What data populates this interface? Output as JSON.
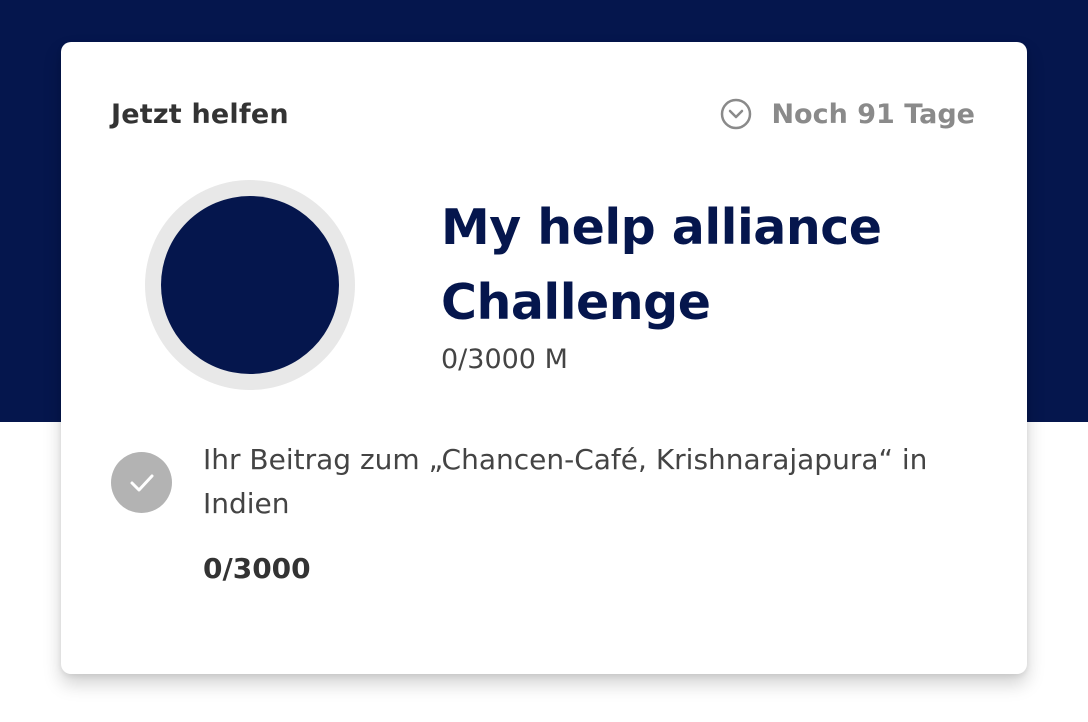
{
  "header": {
    "cta_label": "Jetzt helfen",
    "time_left": "Noch 91 Tage",
    "clock_icon": "clock-icon"
  },
  "challenge": {
    "title": "My help alliance Challenge",
    "progress_text": "0/3000 M",
    "avatar_color": "#05164d"
  },
  "contribution": {
    "icon": "checkmark-icon",
    "text": "Ihr Beitrag zum „Chancen-Café, Krishnarajapura“ in Indien",
    "progress": "0/3000"
  },
  "colors": {
    "brand_navy": "#05164d",
    "check_badge": "#b3b3b3",
    "muted_text": "#8a8a8a"
  }
}
